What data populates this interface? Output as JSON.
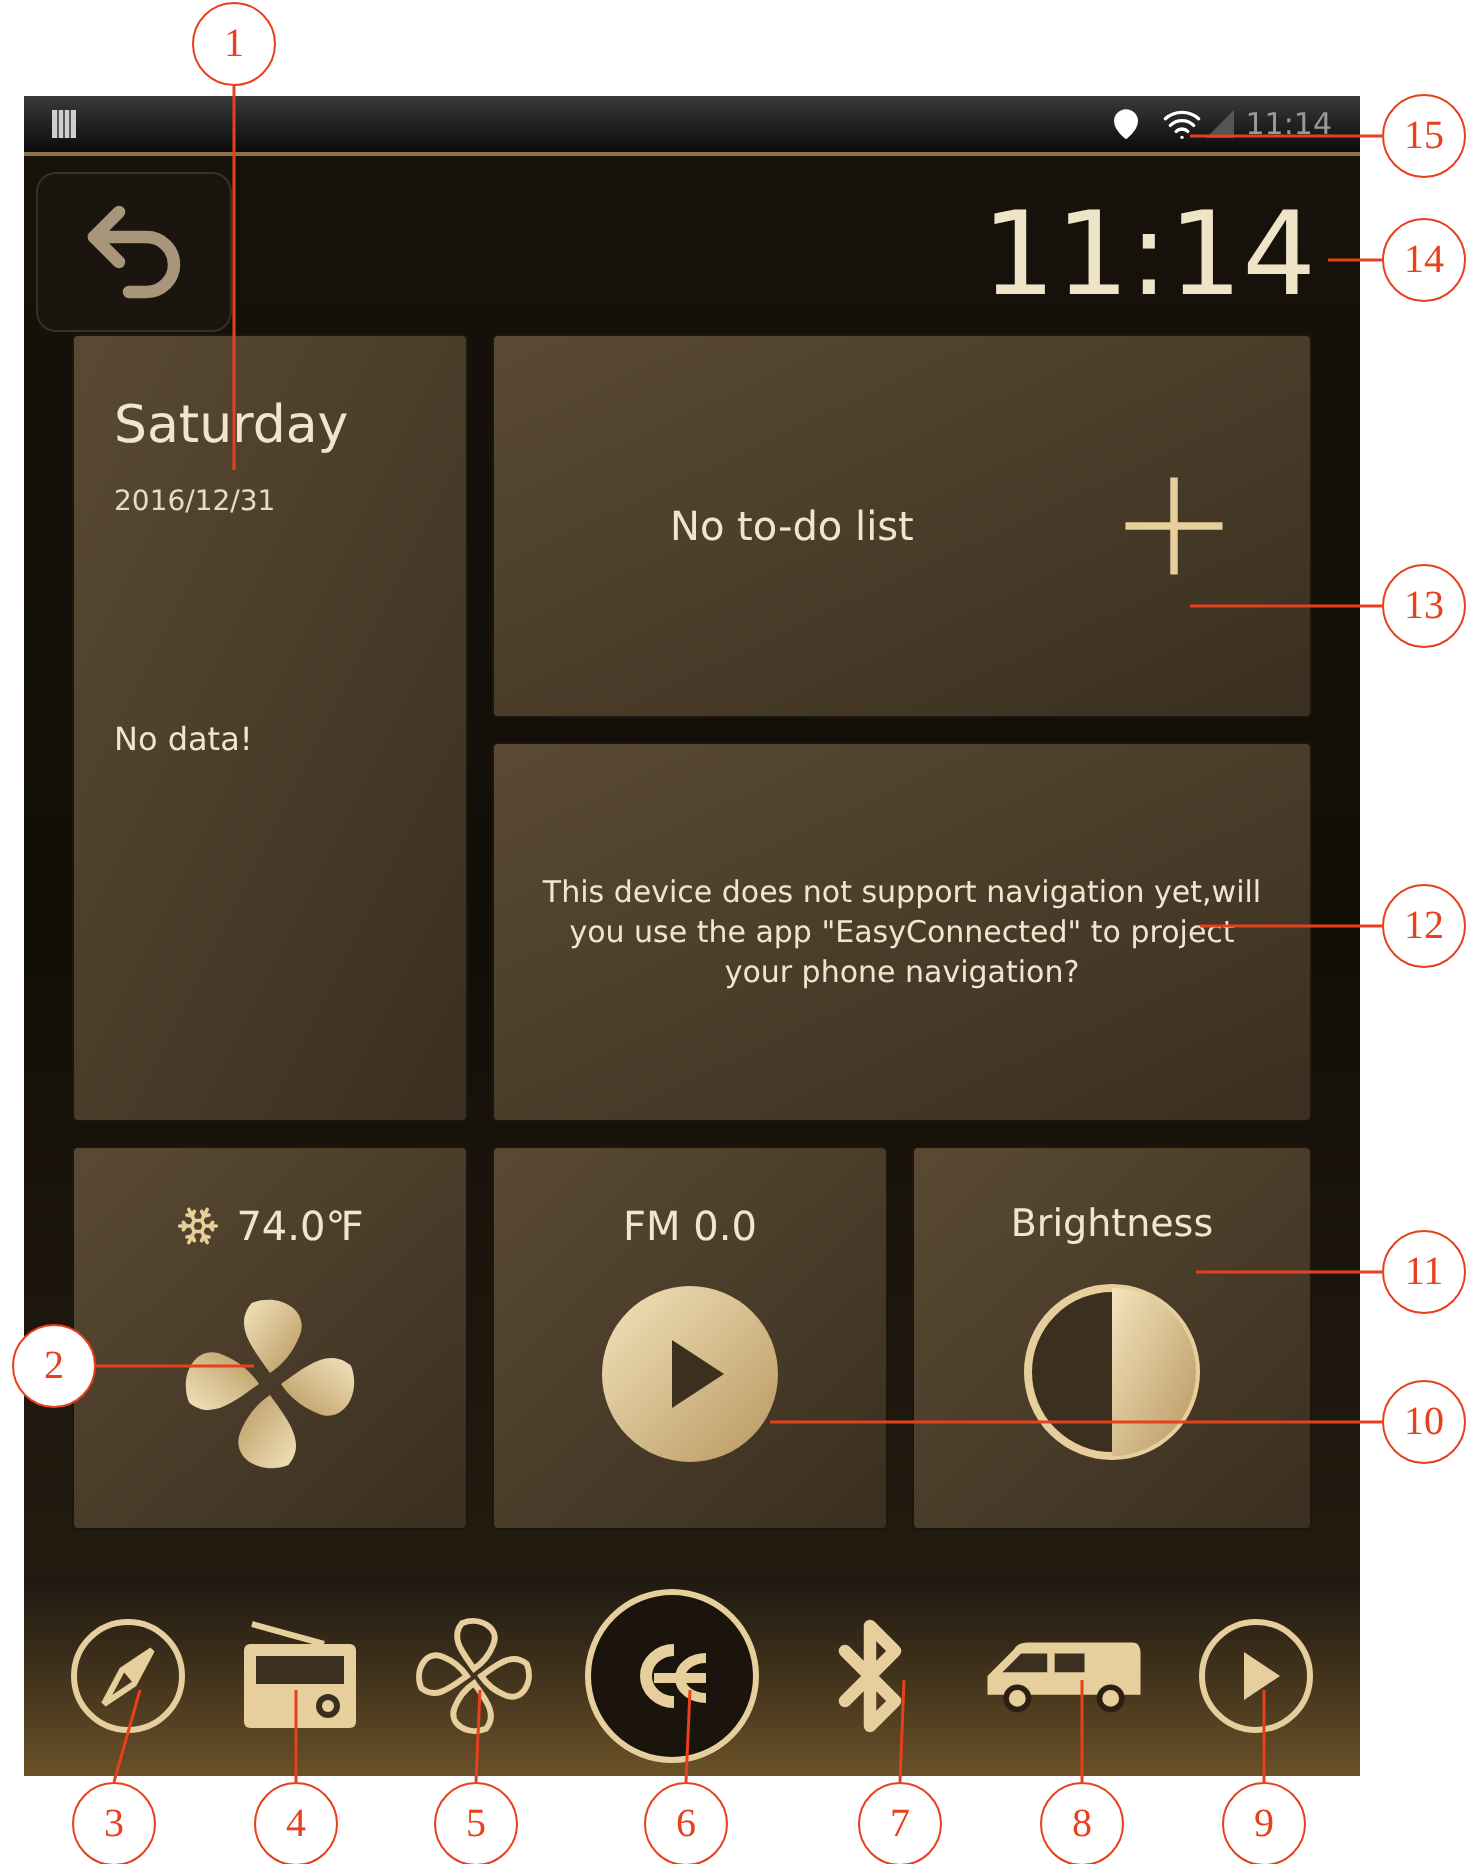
{
  "status_bar": {
    "time": "11:14"
  },
  "clock": "11:14",
  "date_tile": {
    "day": "Saturday",
    "date": "2016/12/31",
    "message": "No data!"
  },
  "todo_tile": {
    "text": "No to-do list"
  },
  "nav_tile": {
    "text": "This device does not support navigation yet,will you use the app \"EasyConnected\" to project your phone navigation?"
  },
  "climate_tile": {
    "temperature": "74.0℉"
  },
  "radio_tile": {
    "station": "FM 0.0"
  },
  "brightness_tile": {
    "label": "Brightness"
  },
  "dock": [
    {
      "kind": "navigation"
    },
    {
      "kind": "radio"
    },
    {
      "kind": "fan"
    },
    {
      "kind": "logo"
    },
    {
      "kind": "bluetooth"
    },
    {
      "kind": "van"
    },
    {
      "kind": "play"
    }
  ],
  "callouts": [
    {
      "label": "1"
    },
    {
      "label": "15"
    },
    {
      "label": "14"
    },
    {
      "label": "13"
    },
    {
      "label": "12"
    },
    {
      "label": "11"
    },
    {
      "label": "2"
    },
    {
      "label": "10"
    },
    {
      "label": "3"
    },
    {
      "label": "4"
    },
    {
      "label": "5"
    },
    {
      "label": "6"
    },
    {
      "label": "7"
    },
    {
      "label": "8"
    },
    {
      "label": "9"
    }
  ]
}
